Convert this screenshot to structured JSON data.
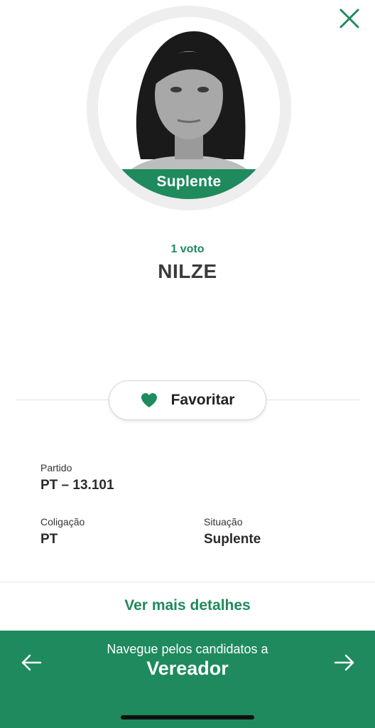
{
  "colors": {
    "accent": "#1e8a5e",
    "text_dark": "#333333",
    "background": "#ffffff"
  },
  "header": {
    "close_icon": "close-icon"
  },
  "candidate": {
    "status_badge": "Suplente",
    "votes": "1 voto",
    "name": "NILZE"
  },
  "favorite": {
    "icon": "heart-icon",
    "label": "Favoritar"
  },
  "info": {
    "partido_label": "Partido",
    "partido_value": "PT – 13.101",
    "coligacao_label": "Coligação",
    "coligacao_value": "PT",
    "situacao_label": "Situação",
    "situacao_value": "Suplente"
  },
  "details_link": "Ver mais detalhes",
  "navigation": {
    "subtitle": "Navegue pelos candidatos a",
    "title": "Vereador",
    "prev_icon": "arrow-left-icon",
    "next_icon": "arrow-right-icon"
  }
}
